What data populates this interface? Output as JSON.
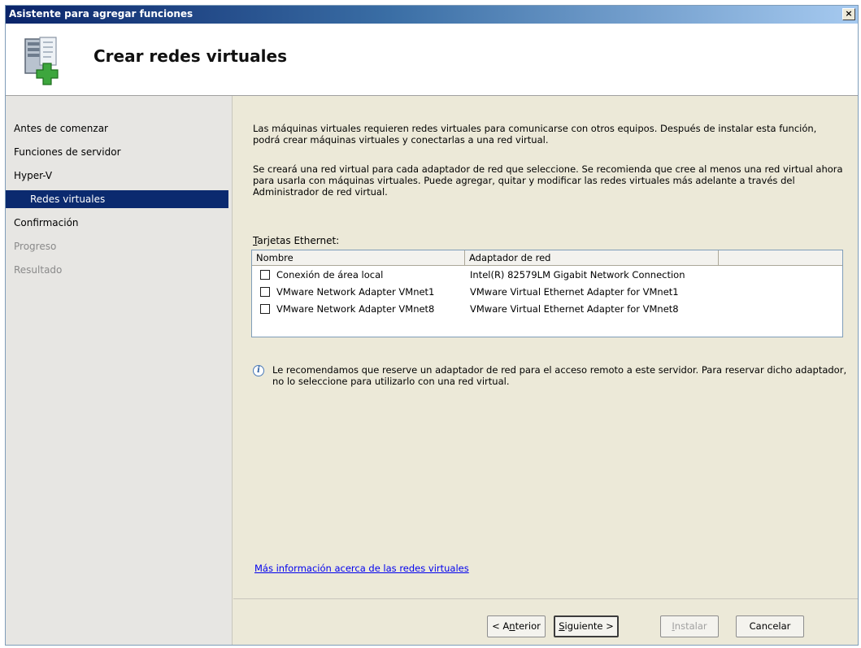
{
  "window": {
    "title": "Asistente para agregar funciones",
    "close_glyph": "×"
  },
  "header": {
    "title": "Crear redes virtuales",
    "icon": "server-add-icon"
  },
  "nav": {
    "items": [
      {
        "label": "Antes de comenzar"
      },
      {
        "label": "Funciones de servidor"
      },
      {
        "label": "Hyper-V"
      },
      {
        "label": "Redes virtuales",
        "selected": true
      },
      {
        "label": "Confirmación"
      },
      {
        "label": "Progreso",
        "disabled": true
      },
      {
        "label": "Resultado",
        "disabled": true
      }
    ]
  },
  "content": {
    "para1": "Las máquinas virtuales requieren redes virtuales para comunicarse con otros equipos. Después de instalar esta función, podrá crear máquinas virtuales y conectarlas a una red virtual.",
    "para2": "Se creará una red virtual para cada adaptador de red que seleccione. Se recomienda que cree al menos una red virtual ahora para usarla con máquinas virtuales. Puede agregar, quitar y modificar las redes virtuales más adelante a través del Administrador de red virtual.",
    "table_label_first": "T",
    "table_label_rest": "arjetas Ethernet:",
    "table": {
      "columns": [
        "Nombre",
        "Adaptador de red"
      ],
      "rows": [
        {
          "name": "Conexión de área local",
          "adapter": "Intel(R) 82579LM Gigabit Network Connection",
          "checked": false
        },
        {
          "name": "VMware Network Adapter VMnet1",
          "adapter": "VMware Virtual Ethernet Adapter for VMnet1",
          "checked": false
        },
        {
          "name": "VMware Network Adapter VMnet8",
          "adapter": "VMware Virtual Ethernet Adapter for VMnet8",
          "checked": false
        }
      ]
    },
    "info_glyph": "i",
    "info_text": "Le recomendamos que reserve un adaptador de red para el acceso remoto a este servidor. Para reservar dicho adaptador, no lo seleccione para utilizarlo con una red virtual.",
    "more_link": "Más información acerca de las redes virtuales"
  },
  "footer": {
    "back": {
      "pre": "< A",
      "ul": "n",
      "post": "terior"
    },
    "next": {
      "pre": "",
      "ul": "S",
      "post": "iguiente >"
    },
    "install": {
      "pre": "",
      "ul": "I",
      "post": "nstalar"
    },
    "cancel": "Cancelar"
  },
  "colors": {
    "selected_bg": "#0b2a6f",
    "link": "#0000ee",
    "titlebar": "#0a246a"
  }
}
